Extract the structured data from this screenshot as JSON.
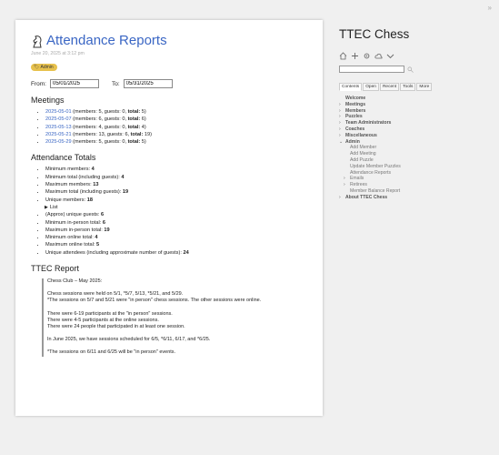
{
  "page": {
    "title": "Attendance Reports",
    "date": "June 20, 2025 at 3:12 pm",
    "badge": "Admin",
    "from_label": "From:",
    "from_value": "05/01/2025",
    "to_label": "To:",
    "to_value": "05/31/2025"
  },
  "meetings": {
    "heading": "Meetings",
    "items": [
      {
        "date": "2025-05-01",
        "members": "5",
        "guests": "0",
        "total": "5"
      },
      {
        "date": "2025-05-07",
        "members": "6",
        "guests": "0",
        "total": "6"
      },
      {
        "date": "2025-05-13",
        "members": "4",
        "guests": "0",
        "total": "4"
      },
      {
        "date": "2025-05-21",
        "members": "13",
        "guests": "6",
        "total": "19"
      },
      {
        "date": "2025-05-29",
        "members": "5",
        "guests": "0",
        "total": "5"
      }
    ]
  },
  "totals": {
    "heading": "Attendance Totals",
    "min_members_label": "Minimum members:",
    "min_members": "4",
    "min_total_label": "Minimum total (including guests):",
    "min_total": "4",
    "max_members_label": "Maximum members:",
    "max_members": "13",
    "max_total_label": "Maximum total (including guests):",
    "max_total": "19",
    "unique_members_label": "Unique members:",
    "unique_members": "18",
    "list_label": "List",
    "unique_guests_label": "(Approx) unique guests:",
    "unique_guests": "6",
    "min_inperson_label": "Minimum in-person total:",
    "min_inperson": "6",
    "max_inperson_label": "Maximum in-person total:",
    "max_inperson": "19",
    "min_online_label": "Minimum online total:",
    "min_online": "4",
    "max_online_label": "Maximum online total:",
    "max_online": "5",
    "unique_attendees_label": "Unique attendees (including approximate number of guests):",
    "unique_attendees": "24"
  },
  "report": {
    "heading": "TTEC Report",
    "p1": "Chess Club – May 2025:",
    "p2a": "Chess sessions were held on 5/1, *5/7, 5/13, *5/21, and 5/29.",
    "p2b": "*The sessions on 5/7 and 5/21 were \"in person\" chess sessions. The other sessions were online.",
    "p3a": "There were 6-19 participants at the \"in person\" sessions.",
    "p3b": "There were 4-5 participants at the online sessions.",
    "p3c": "There were 24 people that participated in at least one session.",
    "p4": "In June 2025, we have sessions scheduled for 6/5, *6/11, 6/17, and *6/25.",
    "p5": "*The sessions on 6/11 and 6/25 will be \"in person\" events."
  },
  "sidebar": {
    "title": "TTEC Chess",
    "tabs": [
      "Contents",
      "Open",
      "Recent",
      "Tools",
      "More"
    ],
    "nav": {
      "welcome": "Welcome",
      "meetings": "Meetings",
      "members": "Members",
      "puzzles": "Puzzles",
      "team_admins": "Team Administrators",
      "coaches": "Coaches",
      "misc": "Miscellaneous",
      "admin": "Admin",
      "add_member": "Add Member",
      "add_meeting": "Add Meeting",
      "add_puzzle": "Add Puzzle",
      "update_puzzles": "Update Member Puzzles",
      "attendance_reports": "Attendance Reports",
      "emails": "Emails",
      "retirees": "Retirees",
      "balance_report": "Member Balance Report",
      "about": "About TTEC Chess"
    }
  },
  "labels": {
    "members": "members:",
    "guests": "guests:",
    "total": "total:"
  }
}
